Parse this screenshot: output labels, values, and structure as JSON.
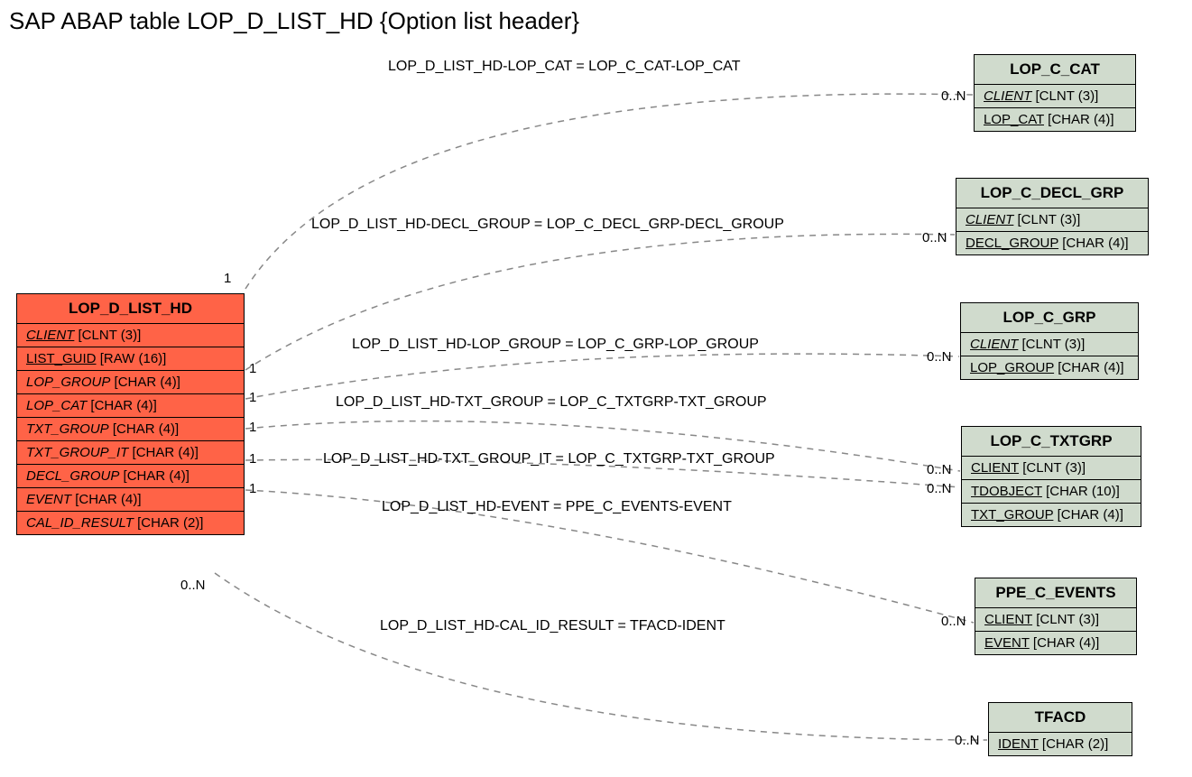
{
  "title": "SAP ABAP table LOP_D_LIST_HD {Option list header}",
  "main_entity": {
    "name": "LOP_D_LIST_HD",
    "fields": [
      {
        "name": "CLIENT",
        "type": "[CLNT (3)]",
        "style": "italic-underline"
      },
      {
        "name": "LIST_GUID",
        "type": "[RAW (16)]",
        "style": "underline"
      },
      {
        "name": "LOP_GROUP",
        "type": "[CHAR (4)]",
        "style": "italic"
      },
      {
        "name": "LOP_CAT",
        "type": "[CHAR (4)]",
        "style": "italic"
      },
      {
        "name": "TXT_GROUP",
        "type": "[CHAR (4)]",
        "style": "italic"
      },
      {
        "name": "TXT_GROUP_IT",
        "type": "[CHAR (4)]",
        "style": "italic"
      },
      {
        "name": "DECL_GROUP",
        "type": "[CHAR (4)]",
        "style": "italic"
      },
      {
        "name": "EVENT",
        "type": "[CHAR (4)]",
        "style": "italic"
      },
      {
        "name": "CAL_ID_RESULT",
        "type": "[CHAR (2)]",
        "style": "italic"
      }
    ]
  },
  "ref_entities": [
    {
      "name": "LOP_C_CAT",
      "fields": [
        {
          "name": "CLIENT",
          "type": "[CLNT (3)]",
          "style": "italic-underline"
        },
        {
          "name": "LOP_CAT",
          "type": "[CHAR (4)]",
          "style": "underline"
        }
      ]
    },
    {
      "name": "LOP_C_DECL_GRP",
      "fields": [
        {
          "name": "CLIENT",
          "type": "[CLNT (3)]",
          "style": "italic-underline"
        },
        {
          "name": "DECL_GROUP",
          "type": "[CHAR (4)]",
          "style": "underline"
        }
      ]
    },
    {
      "name": "LOP_C_GRP",
      "fields": [
        {
          "name": "CLIENT",
          "type": "[CLNT (3)]",
          "style": "italic-underline"
        },
        {
          "name": "LOP_GROUP",
          "type": "[CHAR (4)]",
          "style": "underline"
        }
      ]
    },
    {
      "name": "LOP_C_TXTGRP",
      "fields": [
        {
          "name": "CLIENT",
          "type": "[CLNT (3)]",
          "style": "underline"
        },
        {
          "name": "TDOBJECT",
          "type": "[CHAR (10)]",
          "style": "underline"
        },
        {
          "name": "TXT_GROUP",
          "type": "[CHAR (4)]",
          "style": "underline"
        }
      ]
    },
    {
      "name": "PPE_C_EVENTS",
      "fields": [
        {
          "name": "CLIENT",
          "type": "[CLNT (3)]",
          "style": "underline"
        },
        {
          "name": "EVENT",
          "type": "[CHAR (4)]",
          "style": "underline"
        }
      ]
    },
    {
      "name": "TFACD",
      "fields": [
        {
          "name": "IDENT",
          "type": "[CHAR (2)]",
          "style": "underline"
        }
      ]
    }
  ],
  "relationships": [
    {
      "label": "LOP_D_LIST_HD-LOP_CAT = LOP_C_CAT-LOP_CAT",
      "left_card": "1",
      "right_card": "0..N"
    },
    {
      "label": "LOP_D_LIST_HD-DECL_GROUP = LOP_C_DECL_GRP-DECL_GROUP",
      "left_card": "1",
      "right_card": "0..N"
    },
    {
      "label": "LOP_D_LIST_HD-LOP_GROUP = LOP_C_GRP-LOP_GROUP",
      "left_card": "1",
      "right_card": "0..N"
    },
    {
      "label": "LOP_D_LIST_HD-TXT_GROUP = LOP_C_TXTGRP-TXT_GROUP",
      "left_card": "1",
      "right_card": "0..N"
    },
    {
      "label": "LOP_D_LIST_HD-TXT_GROUP_IT = LOP_C_TXTGRP-TXT_GROUP",
      "left_card": "1",
      "right_card": "0..N"
    },
    {
      "label": "LOP_D_LIST_HD-EVENT = PPE_C_EVENTS-EVENT",
      "left_card": "1",
      "right_card": "0..N"
    },
    {
      "label": "LOP_D_LIST_HD-CAL_ID_RESULT = TFACD-IDENT",
      "left_card": "0..N",
      "right_card": "0..N"
    }
  ]
}
